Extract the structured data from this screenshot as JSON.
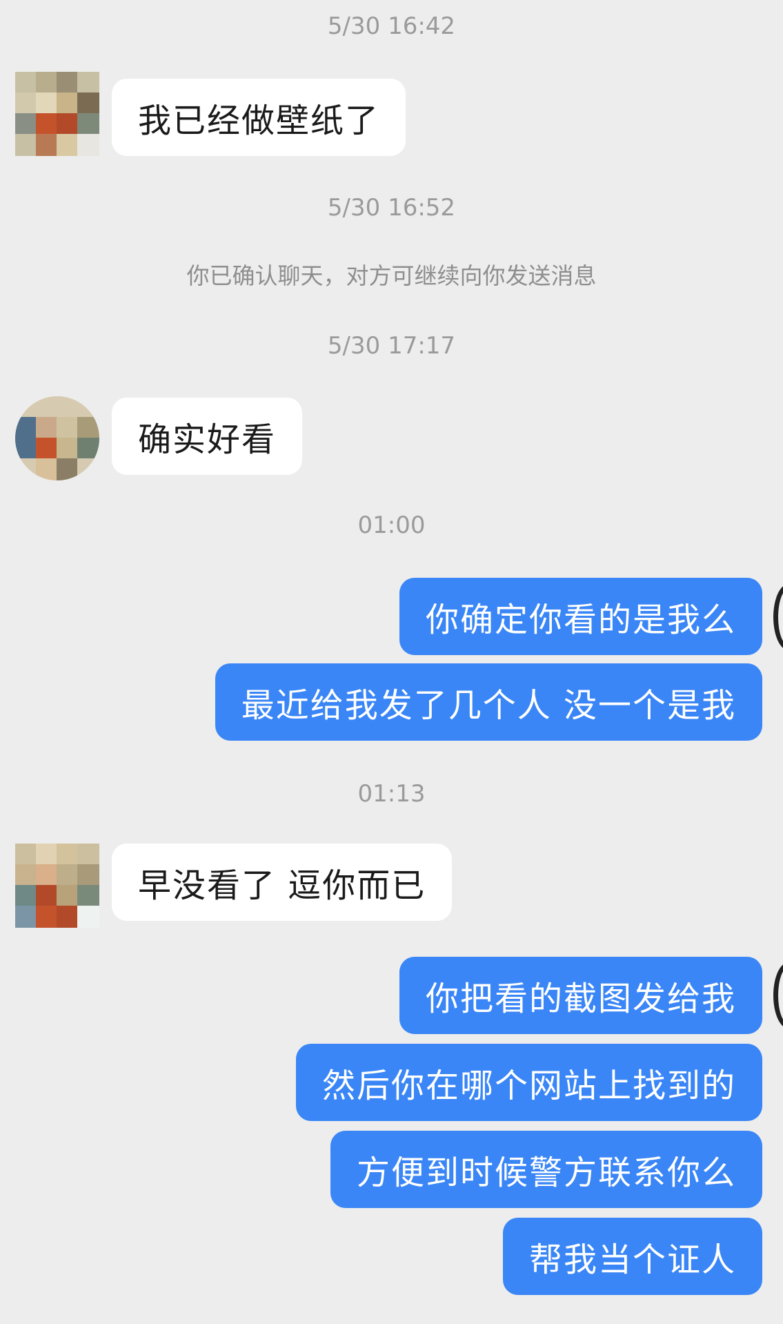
{
  "conversation": {
    "timestamps": [
      "5/30 16:42",
      "5/30 16:52",
      "5/30 17:17",
      "01:00",
      "01:13"
    ],
    "system_notice": "你已确认聊天，对方可继续向你发送消息",
    "incoming": [
      "我已经做壁纸了",
      "确实好看",
      "早没看了 逗你而已"
    ],
    "outgoing": [
      "你确定你看的是我么",
      "最近给我发了几个人 没一个是我",
      "你把看的截图发给我",
      "然后你在哪个网站上找到的",
      "方便到时候警方联系你么",
      "帮我当个证人"
    ]
  },
  "colors": {
    "background": "#ededed",
    "incoming_bubble": "#ffffff",
    "outgoing_bubble": "#3a86f6",
    "timestamp_text": "#9a9a9a"
  }
}
